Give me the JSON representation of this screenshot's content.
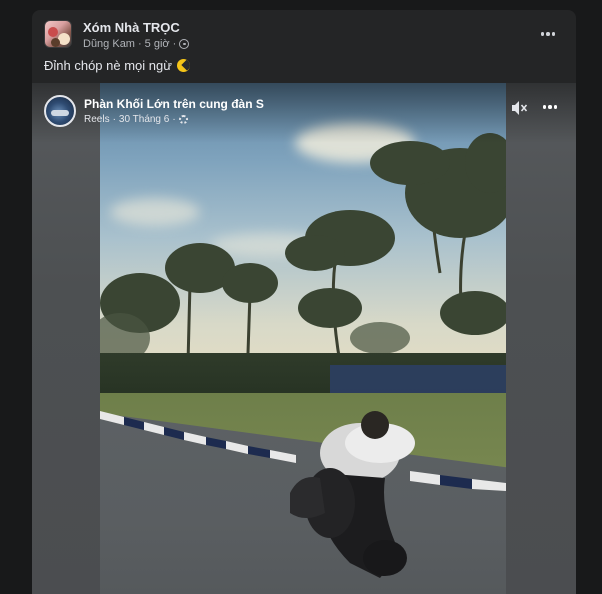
{
  "post": {
    "group_name": "Xóm Nhà TRỌC",
    "author": "Dũng Kam",
    "separator": "·",
    "time": "5 giờ",
    "caption": "Đỉnh chóp nè mọi ngừ"
  },
  "reel": {
    "title": "Phàn Khối Lớn trên cung đàn S",
    "source": "Reels",
    "separator": "·",
    "date": "30 Tháng 6"
  },
  "icons": {
    "post_more": "more-horizontal-icon",
    "audience": "globe-icon",
    "emoji": "pacman-emoji-icon",
    "mute": "volume-muted-icon",
    "reel_more": "more-horizontal-icon",
    "reel_settings": "gear-icon"
  },
  "colors": {
    "page_bg": "#18191a",
    "card_bg": "#242526",
    "primary_text": "#e4e6eb",
    "secondary_text": "#b0b3b8"
  }
}
